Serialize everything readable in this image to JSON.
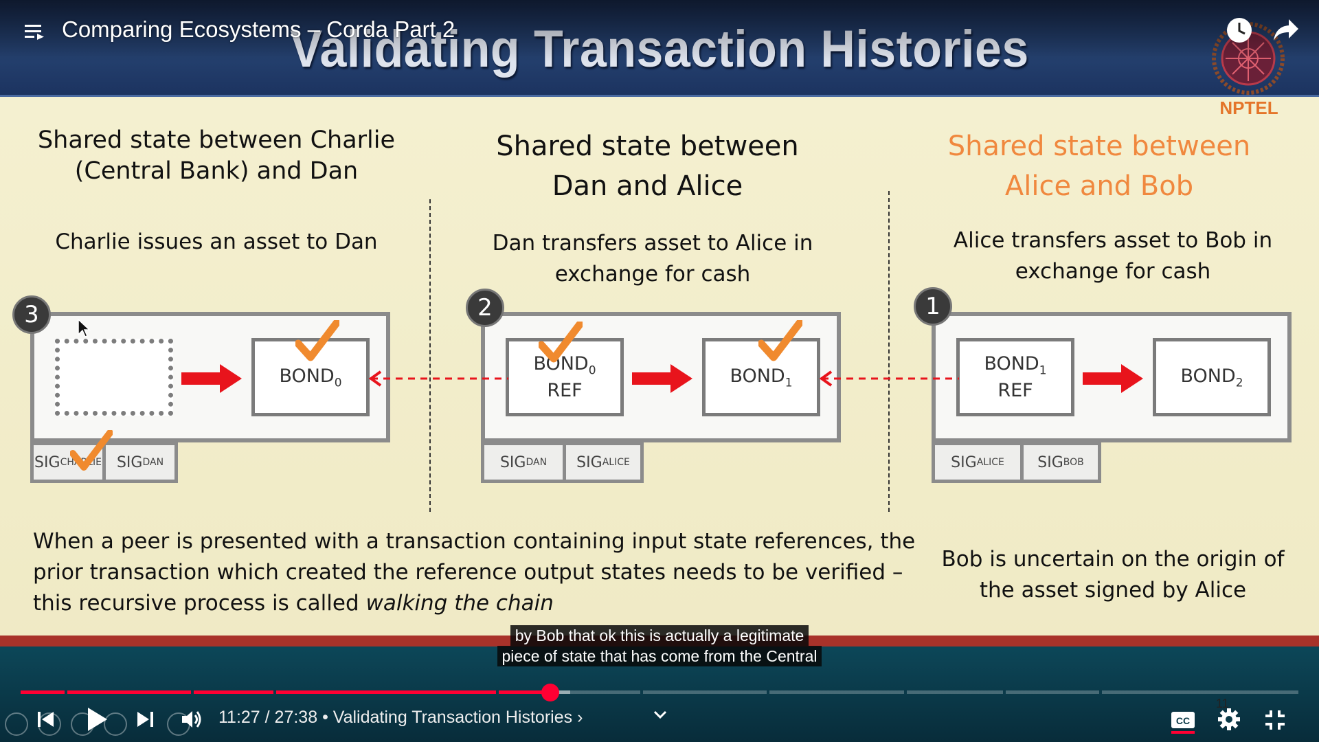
{
  "player": {
    "video_title": "Comparing Ecosystems – Corda Part 2",
    "time_current": "11:27",
    "time_total": "27:38",
    "time_display": "11:27 / 27:38",
    "chapter_separator": "•",
    "chapter_title": "Validating Transaction Histories",
    "chapter_arrow": "›",
    "small_number": "11",
    "progress_fraction": 0.4144,
    "buffered_fraction": 0.43,
    "accent_color": "#ff0033",
    "caption_lines": [
      "by Bob that ok this is actually a legitimate",
      "piece of state that has come from the Central"
    ],
    "icons": {
      "menu": "playlist-menu-icon",
      "watch_later": "clock-icon",
      "share": "share-icon",
      "prev": "previous-icon",
      "play": "play-icon",
      "next": "next-icon",
      "volume": "volume-icon",
      "chevron": "chevron-down-icon",
      "cc": "closed-captions-icon",
      "settings": "gear-icon",
      "fullscreen": "exit-fullscreen-icon"
    }
  },
  "slide": {
    "title": "Validating Transaction Histories",
    "logo_text": "NPTEL",
    "columns": [
      {
        "heading_line1": "Shared state between Charlie",
        "heading_line2": "(Central Bank) and Dan",
        "sub_line1": "Charlie issues an asset to Dan",
        "sub_line2": "",
        "badge": "3",
        "heading_color": "#111111",
        "bond_output": "BOND",
        "bond_output_sub": "0",
        "sig1": "SIG",
        "sig1_sub": "CHARLIE",
        "sig2": "SIG",
        "sig2_sub": "DAN"
      },
      {
        "heading_line1": "Shared state between",
        "heading_line2": "Dan and Alice",
        "sub_line1": "Dan transfers asset to Alice in",
        "sub_line2": "exchange for cash",
        "badge": "2",
        "heading_color": "#111111",
        "bond_input": "BOND",
        "bond_input_sub": "0",
        "bond_input_ref": "REF",
        "bond_output": "BOND",
        "bond_output_sub": "1",
        "sig1": "SIG",
        "sig1_sub": "DAN",
        "sig2": "SIG",
        "sig2_sub": "ALICE"
      },
      {
        "heading_line1": "Shared state between",
        "heading_line2": "Alice and Bob",
        "sub_line1": "Alice transfers asset to Bob in",
        "sub_line2": "exchange for cash",
        "badge": "1",
        "heading_color": "#f0883e",
        "bond_input": "BOND",
        "bond_input_sub": "1",
        "bond_input_ref": "REF",
        "bond_output": "BOND",
        "bond_output_sub": "2",
        "sig1": "SIG",
        "sig1_sub": "ALICE",
        "sig2": "SIG",
        "sig2_sub": "BOB"
      }
    ],
    "bottom_left_pre": "When a peer is presented with a transaction containing input state references, the prior transaction which created the reference output states needs to be verified – this recursive process is called ",
    "bottom_left_em": "walking the chain",
    "bottom_right_line1": "Bob is uncertain on the origin of",
    "bottom_right_line2": "the asset signed by Alice",
    "colors": {
      "arrow": "#e8141c",
      "check": "#f08a2e",
      "banner": "#1f3866"
    }
  }
}
